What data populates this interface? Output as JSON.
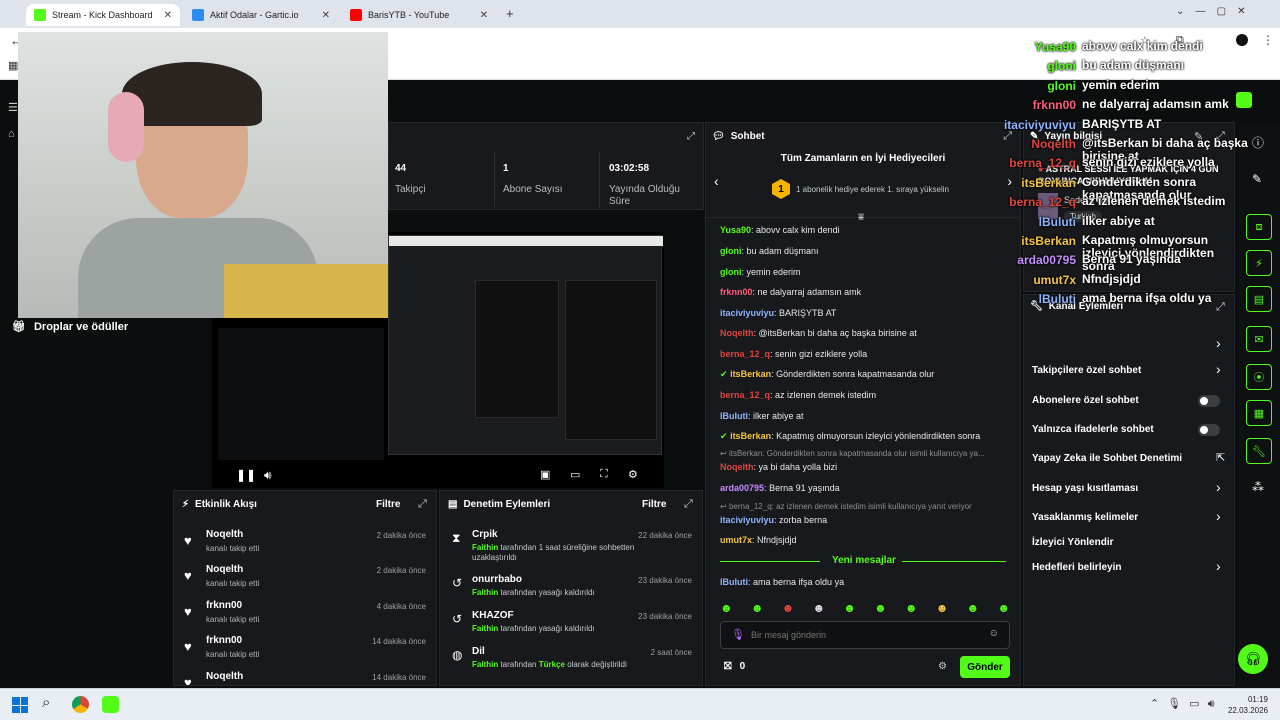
{
  "browser": {
    "tabs": [
      {
        "title": "Stream - Kick Dashboard",
        "color": "#53fc18",
        "active": true
      },
      {
        "title": "Aktif Odalar - Gartic.io",
        "color": "#2d8cf0",
        "active": false
      },
      {
        "title": "BarisYTB - YouTube",
        "color": "#ff0000",
        "active": false
      }
    ],
    "new_tab": "+"
  },
  "stats": [
    {
      "value": "44",
      "label": "Takipçi"
    },
    {
      "value": "1",
      "label": "Abone Sayısı"
    },
    {
      "value": "03:02:58",
      "label": "Yayında Olduğu Süre"
    }
  ],
  "left_nav": {
    "drops": "Droplar ve ödüller"
  },
  "activity": {
    "title": "Etkinlik Akışı",
    "filter": "Filtre",
    "items": [
      {
        "name": "Noqelth",
        "sub": "kanalı takip etti",
        "time": "2 dakika önce"
      },
      {
        "name": "Noqelth",
        "sub": "kanalı takip etti",
        "time": "2 dakika önce"
      },
      {
        "name": "frknn00",
        "sub": "kanalı takip etti",
        "time": "4 dakika önce"
      },
      {
        "name": "frknn00",
        "sub": "kanalı takip etti",
        "time": "14 dakika önce"
      },
      {
        "name": "Noqelth",
        "sub": "",
        "time": "14 dakika önce"
      }
    ]
  },
  "moderation": {
    "title": "Denetim Eylemleri",
    "filter": "Filtre",
    "items": [
      {
        "name": "Crpik",
        "mod": "Faithin",
        "text": "tarafından 1 saat süreliğine sohbetten uzaklaştırıldı",
        "time": "22 dakika önce",
        "icon": "hourglass-icon"
      },
      {
        "name": "onurrbabo",
        "mod": "Faithin",
        "text": "tarafından yasağı kaldırıldı",
        "time": "23 dakika önce",
        "icon": "undo-icon"
      },
      {
        "name": "KHAZOF",
        "mod": "Faithin",
        "text": "tarafından yasağı kaldırıldı",
        "time": "23 dakika önce",
        "icon": "undo-icon"
      },
      {
        "name": "Dil",
        "mod": "Faithin",
        "text_pre": "tarafından",
        "highlight": "Türkçe",
        "text": "olarak değiştirildi",
        "time": "2 saat önce",
        "icon": "globe-icon"
      }
    ]
  },
  "chat": {
    "title": "Sohbet",
    "gifters_title": "Tüm Zamanların en İyi Hediyecileri",
    "gifters_badge": "1",
    "gifters_text": "1 abonelik hediye ederek 1. sıraya yükselin",
    "messages": [
      {
        "user": "Yusa90",
        "color": "#53fc18",
        "text": "abovv calx kim dendi"
      },
      {
        "user": "gloni",
        "color": "#53fc18",
        "text": "bu adam düşmanı"
      },
      {
        "user": "gloni",
        "color": "#53fc18",
        "text": "yemin ederim"
      },
      {
        "user": "frknn00",
        "color": "#ff5c7a",
        "text": "ne dalyarraj adamsın amk"
      },
      {
        "user": "itaciviyuviyu",
        "color": "#8fb4ff",
        "text": "BARIŞYTB AT"
      },
      {
        "user": "Noqelth",
        "color": "#e0443e",
        "text": "@itsBerkan bi daha aç başka birisine at"
      },
      {
        "user": "berna_12_q",
        "color": "#e0443e",
        "text": "senin gizi eziklere yolla"
      },
      {
        "user": "itsBerkan",
        "color": "#f5c542",
        "text": "Gönderdikten sonra kapatmasanda olur",
        "badge": true
      },
      {
        "user": "berna_12_q",
        "color": "#e0443e",
        "text": "az izlenen demek istedim"
      },
      {
        "user": "lBuluti",
        "color": "#8fb4ff",
        "text": "ilker abiye at"
      },
      {
        "user": "itsBerkan",
        "color": "#f5c542",
        "text": "Kapatmış olmuyorsun izleyici yönlendirdikten sonra",
        "badge": true
      }
    ],
    "reply1": "itsBerkan: Gönderdikten sonra kapatmasanda olur isimli kullanıcıya ya...",
    "messages2": [
      {
        "user": "Noqelth",
        "color": "#e0443e",
        "text": "ya bi daha yolla bizi"
      },
      {
        "user": "arda00795",
        "color": "#c58cff",
        "text": "Berna 91 yaşında"
      }
    ],
    "reply2": "berna_12_q: az izlenen demek istedim isimli kullanıcıya yanıt veriyor",
    "messages3": [
      {
        "user": "itaciviyuviyu",
        "color": "#8fb4ff",
        "text": "zorba berna"
      },
      {
        "user": "umut7x",
        "color": "#f5c542",
        "text": "Nfndjsjdjd"
      }
    ],
    "new_messages": "Yeni mesajlar",
    "last": {
      "user": "lBuluti",
      "color": "#8fb4ff",
      "text": "ama berna ifşa oldu ya"
    },
    "input_placeholder": "Bir mesaj gönderin",
    "points": "0",
    "send": "Gönder"
  },
  "stream_info": {
    "title": "Yayın bilgisi",
    "stream_title": "ASTRAL SESSİ İLE YAPMAK İÇİN 4 GÜN BOYUNCA UYUMUYORUM",
    "category": "Sadece Sohbet",
    "language": "Turkish"
  },
  "channel_actions": {
    "title": "Kanal Eylemleri",
    "rows": [
      {
        "label": "Takipçilere özel sohbet",
        "kind": "chevron"
      },
      {
        "label": "Abonelere özel sohbet",
        "kind": "toggle"
      },
      {
        "label": "Yalnızca ifadelerle sohbet",
        "kind": "toggle"
      },
      {
        "label": "Yapay Zeka ile Sohbet Denetimi",
        "kind": "external"
      },
      {
        "label": "Hesap yaşı kısıtlaması",
        "kind": "chevron"
      },
      {
        "label": "Yasaklanmış kelimeler",
        "kind": "chevron"
      },
      {
        "label": "İzleyici Yönlendir",
        "kind": "none"
      },
      {
        "label": "Hedefleri belirleyin",
        "kind": "chevron"
      }
    ]
  },
  "overlay_chat": [
    {
      "user": "Yusa90",
      "color": "#53fc18",
      "text": "abovv calx kim dendi"
    },
    {
      "user": "gloni",
      "color": "#53fc18",
      "text": "bu adam düşmanı"
    },
    {
      "user": "gloni",
      "color": "#53fc18",
      "text": "yemin ederim"
    },
    {
      "user": "frknn00",
      "color": "#ff5c7a",
      "text": "ne dalyarraj adamsın amk"
    },
    {
      "user": "itaciviyuviyu",
      "color": "#8fb4ff",
      "text": "BARIŞYTB AT"
    },
    {
      "user": "Noqelth",
      "color": "#e0443e",
      "text": "@itsBerkan bi daha aç başka birisine at"
    },
    {
      "user": "berna_12_q",
      "color": "#e0443e",
      "text": "senin gizi eziklere yolla"
    },
    {
      "user": "itsBerkan",
      "color": "#f5c542",
      "text": "Gönderdikten sonra kapatmasanda olur"
    },
    {
      "user": "berna_12_q",
      "color": "#e0443e",
      "text": "az izlenen demek istedim"
    },
    {
      "user": "lBuluti",
      "color": "#8fb4ff",
      "text": "ilker abiye at"
    },
    {
      "user": "itsBerkan",
      "color": "#f5c542",
      "text": "Kapatmış olmuyorsun izleyici yönlendirdikten sonra"
    },
    {
      "user": "arda00795",
      "color": "#c58cff",
      "text": "Berna 91 yaşında"
    },
    {
      "user": "umut7x",
      "color": "#f5c542",
      "text": "Nfndjsjdjd"
    },
    {
      "user": "lBuluti",
      "color": "#8fb4ff",
      "text": "ama berna ifşa oldu ya"
    }
  ],
  "taskbar": {
    "time": "01:19",
    "date": "22.03.2026"
  }
}
